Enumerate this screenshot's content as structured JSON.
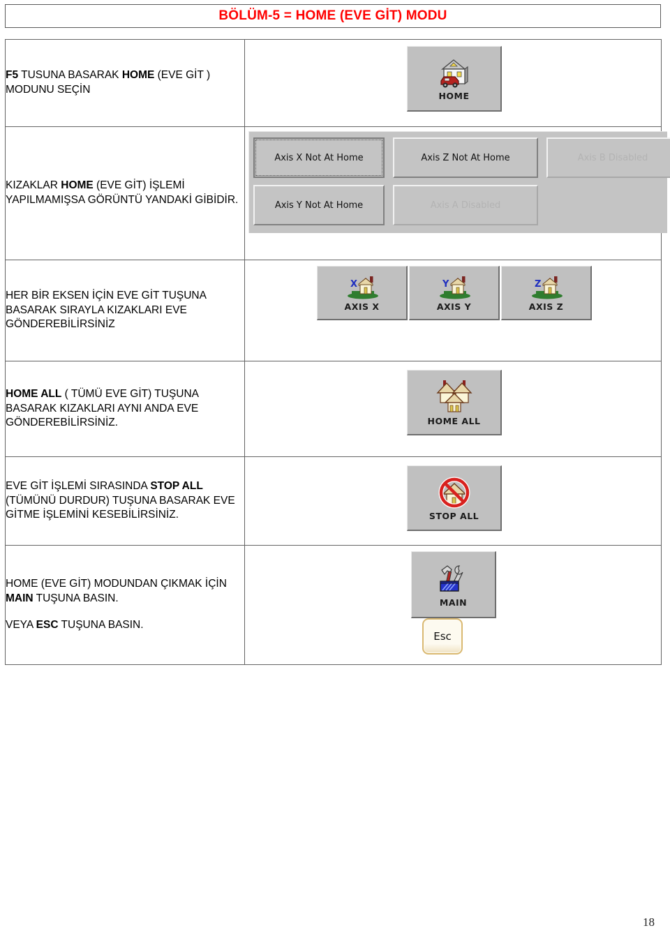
{
  "title": {
    "text": "BÖLÜM-5 = HOME (EVE GİT) MODU",
    "color": "#ff0000"
  },
  "rows": [
    {
      "id": "select-home-mode",
      "text_parts": [
        {
          "t": "F5",
          "b": true
        },
        {
          "t": " TUSUNA BASARAK ",
          "b": false
        },
        {
          "t": "HOME",
          "b": true
        },
        {
          "t": " (EVE GİT ) MODUNU SEÇİN",
          "b": false
        }
      ],
      "visual": "home-button"
    },
    {
      "id": "axis-not-at-home-status",
      "text_parts": [
        {
          "t": "KIZAKLAR ",
          "b": false
        },
        {
          "t": "HOME",
          "b": true
        },
        {
          "t": " (EVE GİT) İŞLEMİ YAPILMAMIŞSA GÖRÜNTÜ YANDAKİ GİBİDİR.",
          "b": false
        }
      ],
      "visual": "axis-status-panel"
    },
    {
      "id": "per-axis-home",
      "text_parts": [
        {
          "t": "HER BİR EKSEN İÇİN EVE GİT TUŞUNA BASARAK SIRAYLA KIZAKLARI EVE GÖNDEREBİLİRSİNİZ",
          "b": false
        }
      ],
      "visual": "axis-buttons"
    },
    {
      "id": "home-all",
      "text_parts": [
        {
          "t": "HOME ALL",
          "b": true
        },
        {
          "t": " ( TÜMÜ EVE GİT) TUŞUNA BASARAK KIZAKLARI AYNI ANDA EVE GÖNDEREBİLİRSİNİZ.",
          "b": false
        }
      ],
      "visual": "home-all-button"
    },
    {
      "id": "stop-all",
      "text_parts": [
        {
          "t": "EVE GİT İŞLEMİ SIRASINDA  ",
          "b": false
        },
        {
          "t": "STOP ALL",
          "b": true
        },
        {
          "t": " (TÜMÜNÜ DURDUR) TUŞUNA BASARAK EVE GİTME İŞLEMİNİ KESEBİLİRSİNİZ.",
          "b": false
        }
      ],
      "visual": "stop-all-button"
    },
    {
      "id": "exit-home-mode",
      "text_parts": [
        {
          "t": "HOME (EVE GİT) MODUNDAN ÇIKMAK İÇİN  ",
          "b": false
        },
        {
          "t": "MAIN",
          "b": true
        },
        {
          "t": " TUŞUNA BASIN.",
          "b": false
        }
      ],
      "text_parts_2": [
        {
          "t": "VEYA  ",
          "b": false
        },
        {
          "t": "ESC",
          "b": true
        },
        {
          "t": "  TUŞUNA BASIN.",
          "b": false
        }
      ],
      "visual": "main-button"
    }
  ],
  "buttons": {
    "home": {
      "label": "HOME",
      "icon": "house-with-car-icon"
    },
    "axis_x": {
      "label": "AXIS X",
      "icon": "house-axis-x-icon",
      "axis_letter": "X"
    },
    "axis_y": {
      "label": "AXIS Y",
      "icon": "house-axis-y-icon",
      "axis_letter": "Y"
    },
    "axis_z": {
      "label": "AXIS Z",
      "icon": "house-axis-z-icon",
      "axis_letter": "Z"
    },
    "home_all": {
      "label": "HOME ALL",
      "icon": "multiple-houses-icon"
    },
    "stop_all": {
      "label": "STOP ALL",
      "icon": "house-prohibited-icon"
    },
    "main": {
      "label": "MAIN",
      "icon": "toolbox-hammer-wrench-icon"
    },
    "esc_key": {
      "label": "Esc"
    }
  },
  "axis_status": {
    "boxes": [
      {
        "label": "Axis X Not At Home",
        "state": "focused"
      },
      {
        "label": "Axis Z Not At Home",
        "state": "normal"
      },
      {
        "label": "Axis B Disabled",
        "state": "disabled"
      },
      {
        "label": "Axis Y Not At Home",
        "state": "normal"
      },
      {
        "label": "Axis A Disabled",
        "state": "disabled"
      },
      {
        "label": "",
        "state": "empty"
      }
    ]
  },
  "footer": {
    "page_number": "18"
  }
}
